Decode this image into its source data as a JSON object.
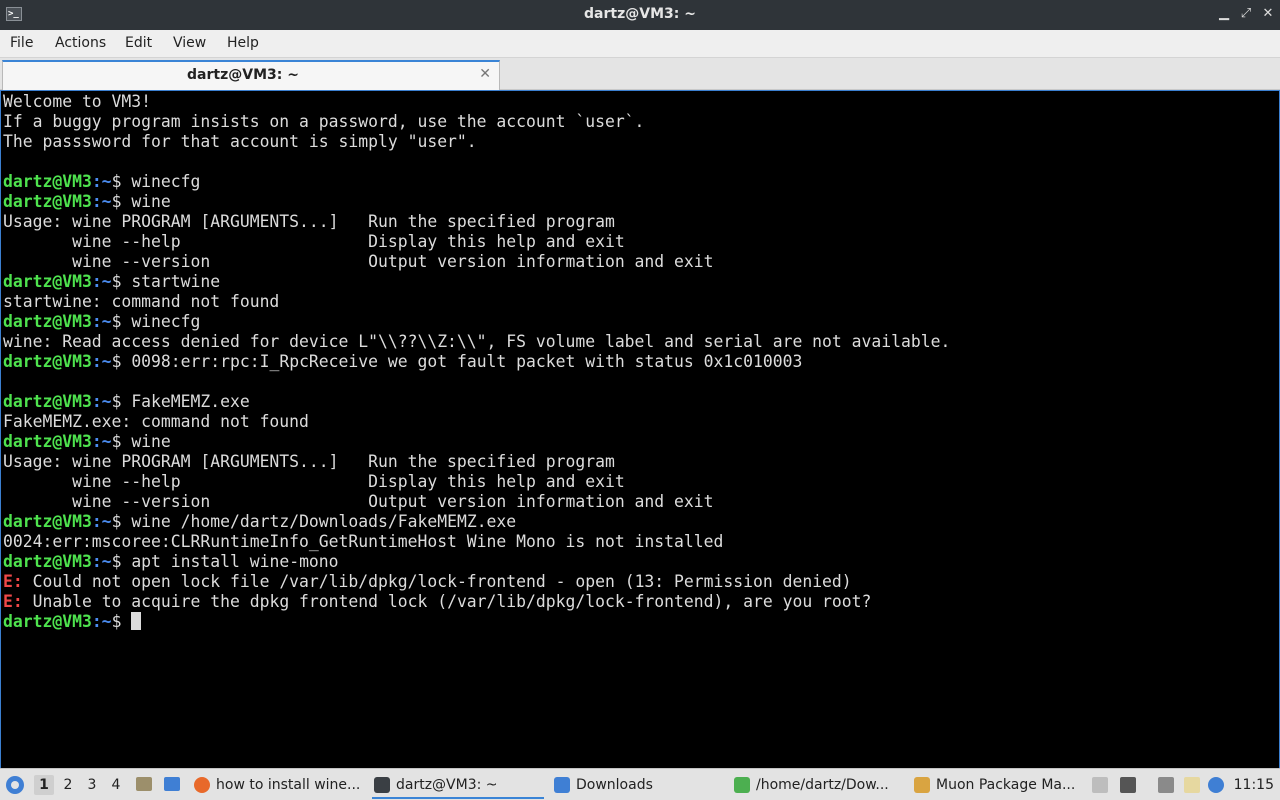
{
  "window": {
    "title": "dartz@VM3: ~",
    "minimize_label": "▁",
    "maximize_label": "⤢",
    "close_label": "✕",
    "app_icon_label": ">_"
  },
  "menu": {
    "items": [
      "File",
      "Actions",
      "Edit",
      "View",
      "Help"
    ]
  },
  "tabs": [
    {
      "label": "dartz@VM3: ~",
      "close_label": "✕"
    }
  ],
  "terminal": {
    "prompt_user": "dartz@VM3",
    "prompt_path": ":~",
    "prompt_symbol": "$ ",
    "lines": [
      {
        "type": "out",
        "text": "Welcome to VM3!"
      },
      {
        "type": "out",
        "text": "If a buggy program insists on a password, use the account `user`."
      },
      {
        "type": "out",
        "text": "The passsword for that account is simply \"user\"."
      },
      {
        "type": "out",
        "text": ""
      },
      {
        "type": "prompt",
        "text": "winecfg"
      },
      {
        "type": "prompt",
        "text": "wine"
      },
      {
        "type": "out",
        "text": "Usage: wine PROGRAM [ARGUMENTS...]   Run the specified program"
      },
      {
        "type": "out",
        "text": "       wine --help                   Display this help and exit"
      },
      {
        "type": "out",
        "text": "       wine --version                Output version information and exit"
      },
      {
        "type": "prompt",
        "text": "startwine"
      },
      {
        "type": "out",
        "text": "startwine: command not found"
      },
      {
        "type": "prompt",
        "text": "winecfg"
      },
      {
        "type": "out",
        "text": "wine: Read access denied for device L\"\\\\??\\\\Z:\\\\\", FS volume label and serial are not available."
      },
      {
        "type": "prompt",
        "text": "0098:err:rpc:I_RpcReceive we got fault packet with status 0x1c010003"
      },
      {
        "type": "out",
        "text": ""
      },
      {
        "type": "prompt",
        "text": "FakeMEMZ.exe"
      },
      {
        "type": "out",
        "text": "FakeMEMZ.exe: command not found"
      },
      {
        "type": "prompt",
        "text": "wine"
      },
      {
        "type": "out",
        "text": "Usage: wine PROGRAM [ARGUMENTS...]   Run the specified program"
      },
      {
        "type": "out",
        "text": "       wine --help                   Display this help and exit"
      },
      {
        "type": "out",
        "text": "       wine --version                Output version information and exit"
      },
      {
        "type": "prompt",
        "text": "wine /home/dartz/Downloads/FakeMEMZ.exe"
      },
      {
        "type": "out",
        "text": "0024:err:mscoree:CLRRuntimeInfo_GetRuntimeHost Wine Mono is not installed"
      },
      {
        "type": "prompt",
        "text": "apt install wine-mono"
      },
      {
        "type": "err",
        "prefix": "E:",
        "text": " Could not open lock file /var/lib/dpkg/lock-frontend - open (13: Permission denied)"
      },
      {
        "type": "err",
        "prefix": "E:",
        "text": " Unable to acquire the dpkg frontend lock (/var/lib/dpkg/lock-frontend), are you root?"
      },
      {
        "type": "cursor",
        "text": ""
      }
    ]
  },
  "taskbar": {
    "workspaces": [
      "1",
      "2",
      "3",
      "4"
    ],
    "active_workspace": "1",
    "tasks": [
      {
        "label": "how to install wine...",
        "icon": "firefox-icon",
        "color": "#e8692a"
      },
      {
        "label": "dartz@VM3: ~",
        "icon": "terminal-icon",
        "color": "#3a3f44",
        "active": true
      },
      {
        "label": "Downloads",
        "icon": "folder-icon",
        "color": "#3f7fd4"
      },
      {
        "label": "/home/dartz/Dow...",
        "icon": "archive-icon",
        "color": "#4caf50"
      },
      {
        "label": "Muon Package Ma...",
        "icon": "package-icon",
        "color": "#d9a441"
      }
    ],
    "clock": "11:15"
  },
  "colors": {
    "prompt_user": "#4ee34e",
    "prompt_path": "#4b8cf0",
    "error": "#f04848",
    "accent": "#3a84d6"
  }
}
